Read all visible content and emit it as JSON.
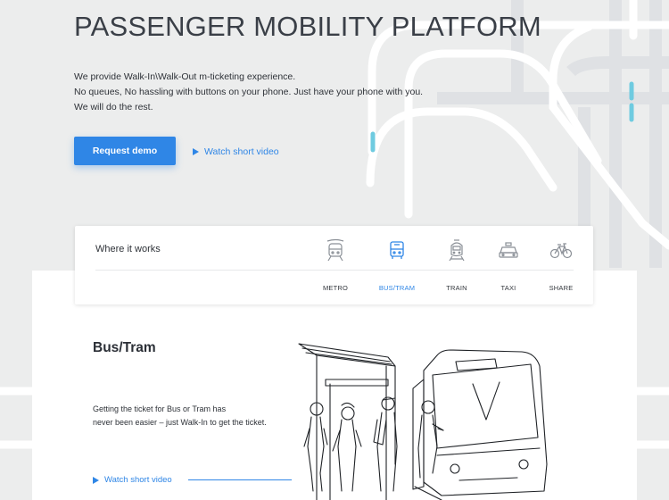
{
  "hero": {
    "title": "PASSENGER MOBILITY PLATFORM",
    "description": [
      "We provide Walk-In\\Walk-Out m-ticketing experience.",
      "No queues, No hassling with buttons on your phone. Just have your phone with you.",
      "We will do the rest."
    ],
    "cta_label": "Request demo",
    "video_link_label": "Watch short video"
  },
  "where_it_works": {
    "title": "Where it works",
    "modes": [
      {
        "label": "METRO",
        "icon": "metro-icon",
        "active": false
      },
      {
        "label": "BUS/TRAM",
        "icon": "bus-icon",
        "active": true
      },
      {
        "label": "TRAIN",
        "icon": "train-icon",
        "active": false
      },
      {
        "label": "TAXI",
        "icon": "taxi-icon",
        "active": false
      },
      {
        "label": "SHARE",
        "icon": "bike-icon",
        "active": false
      }
    ]
  },
  "section": {
    "title": "Bus/Tram",
    "description": [
      "Getting the ticket for Bus or Tram has",
      "never been easier – just Walk-In to get the ticket."
    ],
    "video_link_label": "Watch short video",
    "illustration": "bus-stop-illustration"
  },
  "colors": {
    "accent": "#2f86e6",
    "background": "#eceded",
    "map_road": "#ffffff",
    "map_marker": "#6fcbe0"
  }
}
